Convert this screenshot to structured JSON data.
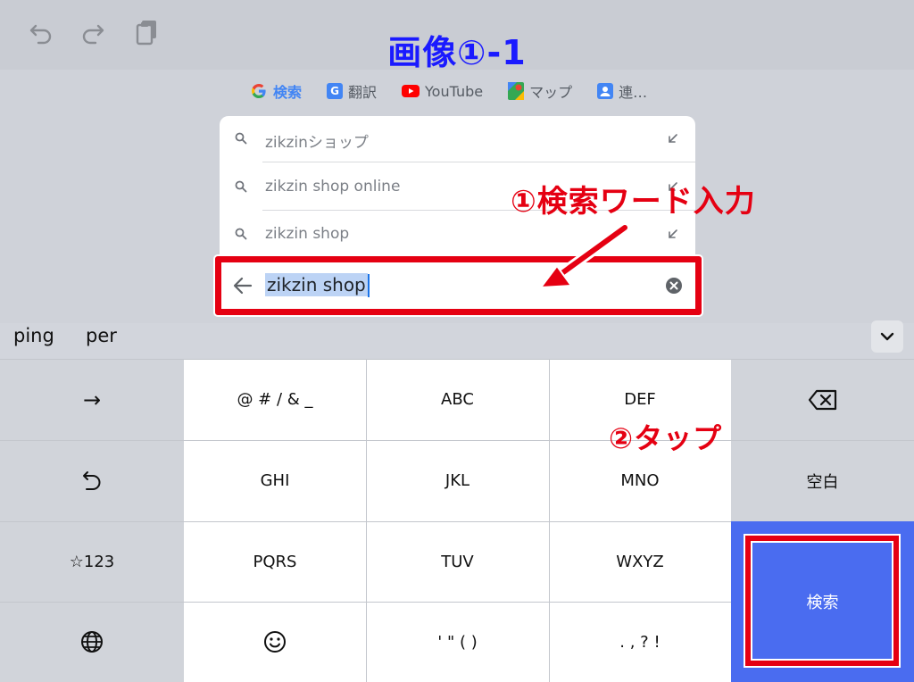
{
  "title": "画像①-1",
  "toolbar": {
    "undo_icon": "undo-icon",
    "redo_icon": "redo-icon",
    "clipboard_icon": "clipboard-icon"
  },
  "shortcuts": [
    {
      "label": "検索",
      "icon": "google-icon",
      "color": "#4285f4"
    },
    {
      "label": "翻訳",
      "icon": "translate-icon",
      "color": "#4285f4"
    },
    {
      "label": "YouTube",
      "icon": "youtube-icon",
      "color": "#ff0000"
    },
    {
      "label": "マップ",
      "icon": "maps-icon",
      "color": "#34a853"
    },
    {
      "label": "連…",
      "icon": "contacts-icon",
      "color": "#4285f4"
    }
  ],
  "suggestions": [
    {
      "text": "zikzinショップ"
    },
    {
      "text": "zikzin shop online"
    },
    {
      "text": "zikzin shop"
    }
  ],
  "search": {
    "value": "zikzin shop"
  },
  "annotations": {
    "step1": "①検索ワード入力",
    "step2": "②タップ"
  },
  "predictions": [
    "ping",
    "per"
  ],
  "keys": {
    "arrow": "→",
    "symbols": "@ # / & _",
    "abc": "ABC",
    "def": "DEF",
    "undo_key": "undo-key-icon",
    "ghi": "GHI",
    "jkl": "JKL",
    "mno": "MNO",
    "space": "空白",
    "num": "☆123",
    "pqrs": "PQRS",
    "tuv": "TUV",
    "wxyz": "WXYZ",
    "search": "検索",
    "quote": "' \" ( )",
    "punct": ". , ? !"
  },
  "colors": {
    "accent_blue": "#4a6cf0",
    "annotation_red": "#e50012",
    "title_blue": "#1a1aff"
  }
}
